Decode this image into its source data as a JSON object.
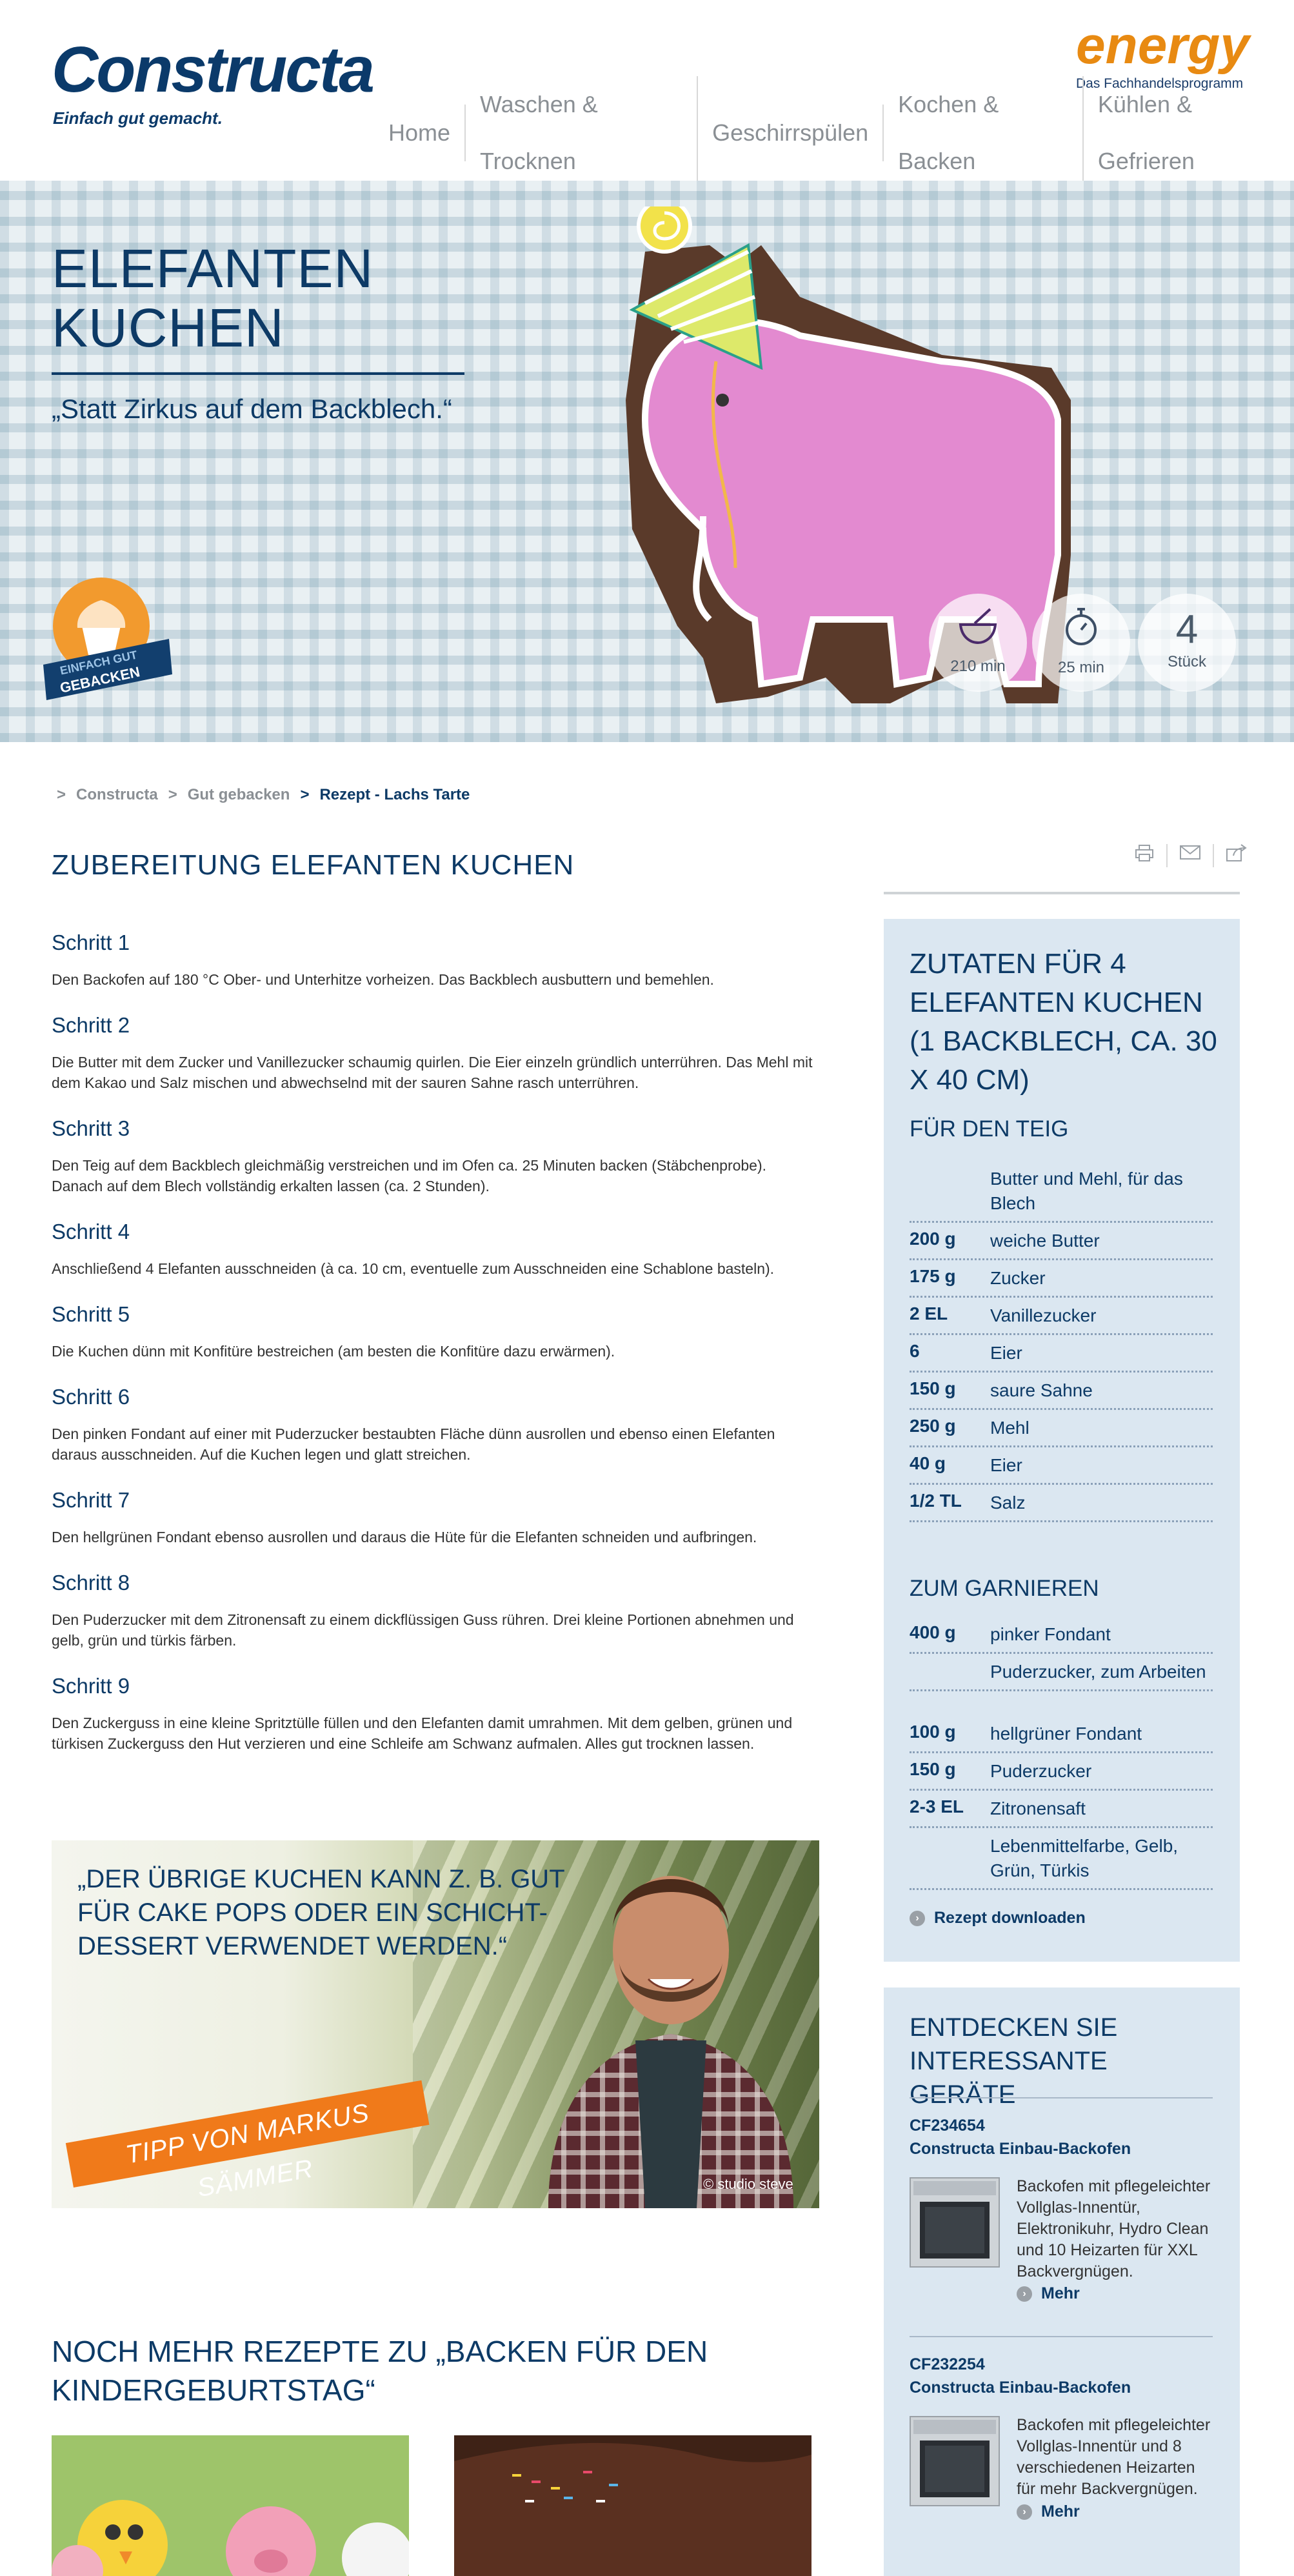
{
  "header": {
    "logo_text": "Constructa",
    "logo_tagline": "Einfach gut gemacht.",
    "energy_text": "energy",
    "energy_sub": "Das Fachhandelsprogramm",
    "nav": [
      "Home",
      "Waschen & Trocknen",
      "Geschirrspülen",
      "Kochen & Backen",
      "Kühlen & Gefrieren"
    ]
  },
  "hero": {
    "title_line1": "ELEFANTEN",
    "title_line2": "KUCHEN",
    "subtitle": "„Statt Zirkus auf dem Backblech.“",
    "badge_line1": "EINFACH GUT",
    "badge_line2": "GEBACKEN",
    "stats": [
      {
        "icon": "bowl-icon",
        "label": "210 min"
      },
      {
        "icon": "stopwatch-icon",
        "label": "25 min"
      },
      {
        "value": "4",
        "label": "Stück"
      }
    ]
  },
  "breadcrumb": [
    ">",
    "Constructa",
    ">",
    "Gut gebacken",
    ">",
    "Rezept - Lachs Tarte"
  ],
  "main": {
    "title": "ZUBEREITUNG ELEFANTEN KUCHEN",
    "steps": [
      {
        "title": "Schritt 1",
        "text": "Den Backofen auf 180 °C Ober- und Unterhitze vorheizen. Das Backblech ausbuttern und bemehlen."
      },
      {
        "title": "Schritt 2",
        "text": "Die Butter mit dem Zucker und Vanillezucker schaumig quirlen. Die Eier einzeln gründlich unterrühren. Das Mehl mit dem Kakao und Salz mischen und abwechselnd mit der sauren Sahne rasch unterrühren."
      },
      {
        "title": "Schritt 3",
        "text": "Den Teig auf dem Backblech gleichmäßig verstreichen und im Ofen ca. 25 Minuten backen (Stäbchenprobe). Danach auf dem Blech vollständig erkalten lassen (ca. 2 Stunden)."
      },
      {
        "title": "Schritt 4",
        "text": "Anschließend 4 Elefanten ausschneiden (à ca. 10 cm, eventuelle zum Ausschneiden eine Schablone basteln)."
      },
      {
        "title": "Schritt 5",
        "text": "Die Kuchen dünn mit Konfitüre bestreichen (am besten die Konfitüre dazu erwärmen)."
      },
      {
        "title": "Schritt 6",
        "text": "Den pinken Fondant auf einer mit Puderzucker bestaubten Fläche dünn ausrollen und ebenso einen Elefanten daraus ausschneiden. Auf die Kuchen legen und glatt streichen."
      },
      {
        "title": "Schritt 7",
        "text": "Den hellgrünen Fondant ebenso ausrollen und daraus die Hüte für die Elefanten schneiden und aufbringen."
      },
      {
        "title": "Schritt 8",
        "text": "Den Puderzucker mit dem Zitronensaft zu einem dickflüssigen Guss rühren. Drei kleine Portionen abnehmen und gelb, grün und türkis färben."
      },
      {
        "title": "Schritt 9",
        "text": "Den Zuckerguss in eine kleine Spritztülle füllen und den Elefanten damit umrahmen. Mit dem gelben, grünen und türkisen Zuckerguss den Hut verzieren und eine Schleife am Schwanz aufmalen. Alles gut trocknen lassen."
      }
    ],
    "quote": "„DER ÜBRIGE KUCHEN KANN Z. B. GUT FÜR CAKE POPS ODER EIN SCHICHT-DESSERT VERWENDET WERDEN.“",
    "quote_banner": "TIPP VON MARKUS SÄMMER",
    "quote_copyright": "© studio steve",
    "more_title": "NOCH MEHR REZEPTE ZU „BACKEN FÜR DEN KINDERGEBURTSTAG“"
  },
  "sidebar": {
    "tools": [
      "print-icon",
      "mail-icon",
      "share-icon"
    ],
    "ingredients_title": "ZUTATEN FÜR 4 ELEFANTEN KUCHEN (1 BACKBLECH, CA. 30 X 40 CM)",
    "dough_title": "FÜR DEN TEIG",
    "dough": [
      {
        "qty": "",
        "name": "Butter und Mehl, für das Blech"
      },
      {
        "qty": "200 g",
        "name": "weiche Butter"
      },
      {
        "qty": "175 g",
        "name": "Zucker"
      },
      {
        "qty": "2 EL",
        "name": "Vanillezucker"
      },
      {
        "qty": "6",
        "name": "Eier"
      },
      {
        "qty": "150 g",
        "name": "saure Sahne"
      },
      {
        "qty": "250 g",
        "name": "Mehl"
      },
      {
        "qty": "40 g",
        "name": "Eier"
      },
      {
        "qty": "1/2 TL",
        "name": "Salz"
      }
    ],
    "garnish_title": "ZUM GARNIEREN",
    "garnish": [
      {
        "qty": "400 g",
        "name": "pinker Fondant"
      },
      {
        "qty": "",
        "name": "Puderzucker, zum Arbeiten"
      },
      {
        "qty": "100 g",
        "name": "hellgrüner Fondant"
      },
      {
        "qty": "150 g",
        "name": "Puderzucker"
      },
      {
        "qty": "2-3 EL",
        "name": "Zitronensaft"
      },
      {
        "qty": "",
        "name": "Lebenmittelfarbe, Gelb, Grün, Türkis"
      }
    ],
    "download_label": "Rezept downloaden",
    "devices_title": "ENTDECKEN SIE INTERESSANTE GERÄTE",
    "products": [
      {
        "id": "CF234654",
        "name": "Constructa Einbau-Backofen",
        "desc": "Backofen mit pflegeleichter Vollglas-Innentür, Elektronikuhr, Hydro Clean und 10 Heizarten für XXL Backvergnügen.",
        "more": "Mehr"
      },
      {
        "id": "CF232254",
        "name": "Constructa Einbau-Backofen",
        "desc": "Backofen mit pflegeleichter Vollglas-Innentür und 8 verschiedenen Heizarten für mehr Backvergnügen.",
        "more": "Mehr"
      }
    ]
  },
  "colors": {
    "brand_blue": "#0d3a66",
    "energy_orange": "#e88a12",
    "sidebar_bg": "#dbe7f1",
    "tip_orange": "#f07a1a"
  }
}
